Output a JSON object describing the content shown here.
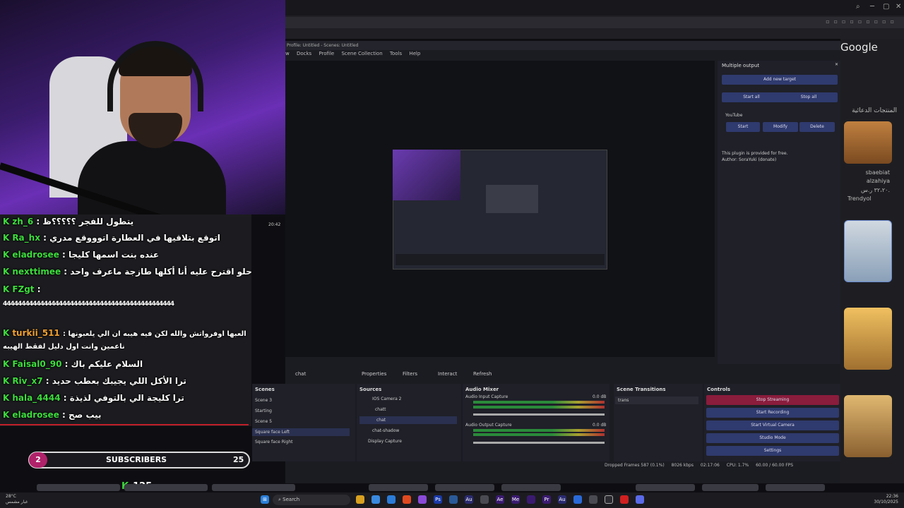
{
  "colors": {
    "accent_green": "#3ddc3d",
    "obs_button": "#2f3a6e",
    "stop_streaming": "#8a1c3c",
    "subs_badge": "#b0226a"
  },
  "browser": {
    "google_label": "Google",
    "product_heading": "المنتجات الدعائية",
    "shop_name": "sbaebiat",
    "shop_sub": "alzahiya",
    "shop_price": "٣٢،٢٠ ر.س.",
    "shop_store": "Trendyol"
  },
  "obs": {
    "title": "Profile: Untitled - Scenes: Untitled",
    "menu": [
      "w",
      "Docks",
      "Profile",
      "Scene Collection",
      "Tools",
      "Help"
    ],
    "source_toolbar": {
      "source": "chat",
      "properties": "Properties",
      "filters": "Filters",
      "interact": "Interact",
      "refresh": "Refresh"
    },
    "multiple_output": {
      "title": "Multiple output",
      "add_target": "Add new target",
      "start_all": "Start all",
      "stop_all": "Stop all",
      "target_name": "YouTube",
      "start": "Start",
      "modify": "Modify",
      "delete": "Delete",
      "note1": "This plugin is provided for free.",
      "note2": "Author: SoraYuki (donate)"
    },
    "scenes": {
      "title": "Scenes",
      "items": [
        "Scene 3",
        "Starting",
        "Scene 5",
        "Square face Left",
        "Square face Right"
      ]
    },
    "sources": {
      "title": "Sources",
      "items": [
        "IOS Camera 2",
        "chatt",
        "chat",
        "chat-shadow",
        "Display Capture"
      ]
    },
    "audio": {
      "title": "Audio Mixer",
      "ch1": "Audio Input Capture",
      "ch1_db": "0.0 dB",
      "ch2": "Audio Output Capture",
      "ch2_db": "0.0 dB"
    },
    "transitions": {
      "title": "Scene Transitions",
      "selected": "trans"
    },
    "controls": {
      "title": "Controls",
      "stop_streaming": "Stop Streaming",
      "start_recording": "Start Recording",
      "start_virtual_camera": "Start Virtual Camera",
      "studio_mode": "Studio Mode",
      "settings": "Settings"
    },
    "status": {
      "dropped": "Dropped Frames 587 (0.1%)",
      "bitrate": "8026 kbps",
      "time": "02:17:06",
      "cpu": "CPU: 1.7%",
      "fps": "60.00 / 60.00 FPS"
    },
    "clock": "20:42"
  },
  "chat": [
    {
      "user": "zh_6",
      "text": ": يتطول للفجر ؟؟؟؟؟ظ"
    },
    {
      "user": "Ra_hx",
      "text": ": اتوقع بتلاقيها في العطارة اتوووقع مدري"
    },
    {
      "user": "eladrosee",
      "text": ": عنده بنت اسمها كليجا"
    },
    {
      "user": "nexttimee",
      "text": ": حلو اقترح عليه أنا أكلها طازجة ماعرف واحد"
    },
    {
      "user": "FZgt",
      "text": ":"
    },
    {
      "user": "",
      "text": "4444444444444444444444444444444444444444444444"
    },
    {
      "user": "turkii_511",
      "text": ": العبها اوفرواتش والله لكن فيه هيبه ان الي يلعبونها"
    },
    {
      "user": "",
      "text": "ناعمين وانت اول دليل لفقط الهيبه"
    },
    {
      "user": "Faisal0_90",
      "text": ": السلام عليكم باك"
    },
    {
      "user": "Riv_x7",
      "text": ": ترا الأكل اللي يجيبك بعطب حديد"
    },
    {
      "user": "hala_4444",
      "text": ": ترا كليجة الي بالتوفي لذيذة"
    },
    {
      "user": "eladrosee",
      "text": ": بيب صح"
    }
  ],
  "subs": {
    "left_count": "2",
    "label": "SUBSCRIBERS",
    "right_count": "25"
  },
  "viewers": "125",
  "taskbar": {
    "search": "Search",
    "weather_temp": "28°C",
    "weather_desc": "غبار مشمس",
    "time": "22:36",
    "date": "30/10/2025"
  }
}
